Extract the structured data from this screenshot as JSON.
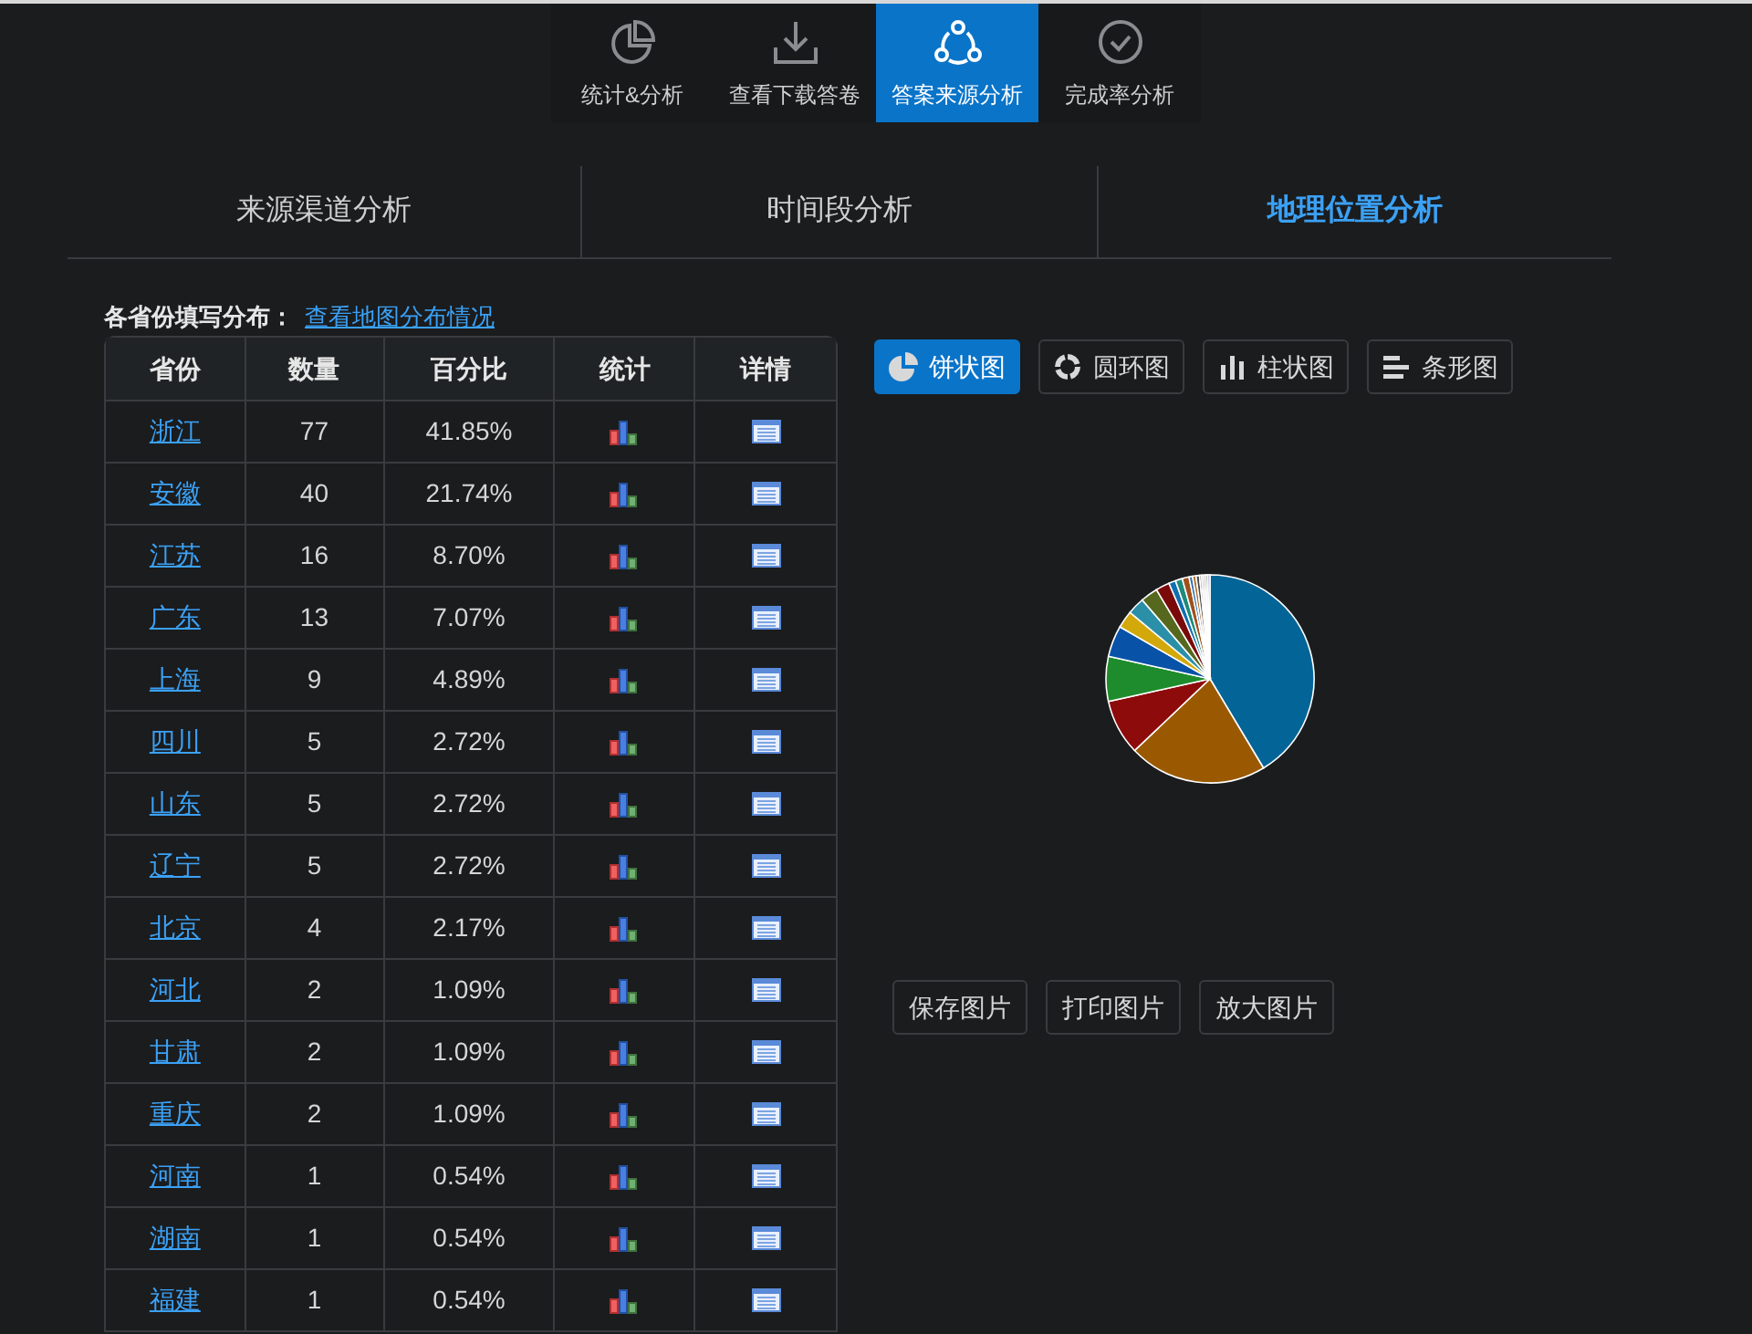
{
  "nav": [
    {
      "label": "统计&分析",
      "kind": "pie",
      "selected": false
    },
    {
      "label": "查看下载答卷",
      "kind": "download",
      "selected": false
    },
    {
      "label": "答案来源分析",
      "kind": "share",
      "selected": true
    },
    {
      "label": "完成率分析",
      "kind": "check",
      "selected": false
    }
  ],
  "subtabs": [
    {
      "label": "来源渠道分析",
      "selected": false
    },
    {
      "label": "时间段分析",
      "selected": false
    },
    {
      "label": "地理位置分析",
      "selected": true
    }
  ],
  "table_title": "各省份填写分布：",
  "map_link": "查看地图分布情况",
  "table": {
    "columns": [
      "省份",
      "数量",
      "百分比",
      "统计",
      "详情"
    ],
    "rows": [
      [
        "浙江",
        "77",
        "41.85%"
      ],
      [
        "安徽",
        "40",
        "21.74%"
      ],
      [
        "江苏",
        "16",
        "8.70%"
      ],
      [
        "广东",
        "13",
        "7.07%"
      ],
      [
        "上海",
        "9",
        "4.89%"
      ],
      [
        "四川",
        "5",
        "2.72%"
      ],
      [
        "山东",
        "5",
        "2.72%"
      ],
      [
        "辽宁",
        "5",
        "2.72%"
      ],
      [
        "北京",
        "4",
        "2.17%"
      ],
      [
        "河北",
        "2",
        "1.09%"
      ],
      [
        "甘肃",
        "2",
        "1.09%"
      ],
      [
        "重庆",
        "2",
        "1.09%"
      ],
      [
        "河南",
        "1",
        "0.54%"
      ],
      [
        "湖南",
        "1",
        "0.54%"
      ],
      [
        "福建",
        "1",
        "0.54%"
      ]
    ]
  },
  "chart_types": [
    {
      "label": "饼状图",
      "kind": "pie",
      "selected": true
    },
    {
      "label": "圆环图",
      "kind": "ring",
      "selected": false
    },
    {
      "label": "柱状图",
      "kind": "column",
      "selected": false
    },
    {
      "label": "条形图",
      "kind": "bar",
      "selected": false
    }
  ],
  "actions": [
    "保存图片",
    "打印图片",
    "放大图片"
  ]
}
